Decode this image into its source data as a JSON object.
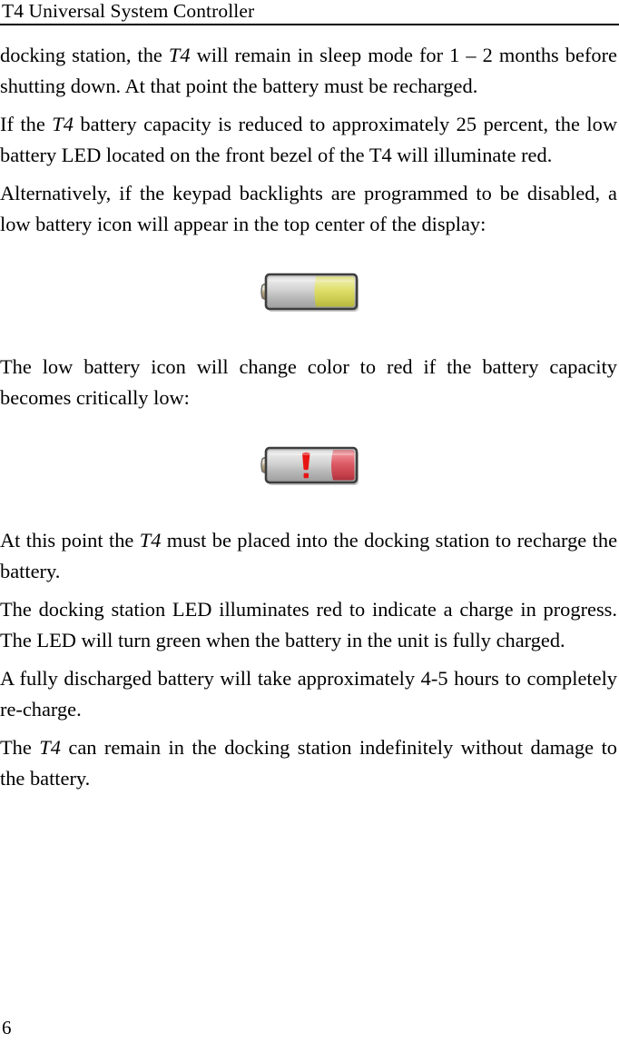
{
  "document": {
    "header_title": "T4 Universal System Controller",
    "page_number": "6"
  },
  "paragraphs": {
    "p1_a": "docking station, the ",
    "p1_it": "T4",
    "p1_b": " will remain in sleep mode for 1 – 2 months before shutting down. At that point the battery must be recharged.",
    "p2_a": "If the ",
    "p2_it": "T4",
    "p2_b": " battery capacity is reduced to approximately 25 percent, the low battery LED located on the front bezel of the T4 will illuminate red.",
    "p3": "Alternatively, if the keypad backlights are programmed to be disabled, a low battery icon will appear in the top center of the display:",
    "p4": "The low battery icon will change color to red if the battery capacity becomes critically low:",
    "p5_a": "At this point the ",
    "p5_it": "T4",
    "p5_b": " must be placed into the docking station to recharge the battery.",
    "p6": "The docking station LED illuminates red to indicate a charge in progress. The LED will turn green when the battery in the unit is fully charged.",
    "p7": "A fully discharged battery will take approximately 4-5 hours to completely re-charge.",
    "p8_a": "The ",
    "p8_it": "T4",
    "p8_b": " can remain in the docking station indefinitely without damage to the battery."
  },
  "figures": {
    "low_battery": {
      "name": "low-battery-icon",
      "description": "Low battery icon: horizontal battery, silver body with yellow charge segment on right",
      "body_color": "#c6c6c6",
      "fill_color": "#d8d85a",
      "terminal_color": "#cbbda2",
      "border_color": "#4a4a4a",
      "fill_percent": 45
    },
    "critical_battery": {
      "name": "critical-battery-icon",
      "description": "Critically low battery icon: horizontal battery, silver body with red exclamation mark and red charge segment on right",
      "body_color": "#c6c6c6",
      "fill_color": "#d9525c",
      "alert_color": "#e21b1b",
      "terminal_color": "#cbbda2",
      "border_color": "#4a4a4a",
      "fill_percent": 26,
      "alert_glyph": "!"
    }
  }
}
